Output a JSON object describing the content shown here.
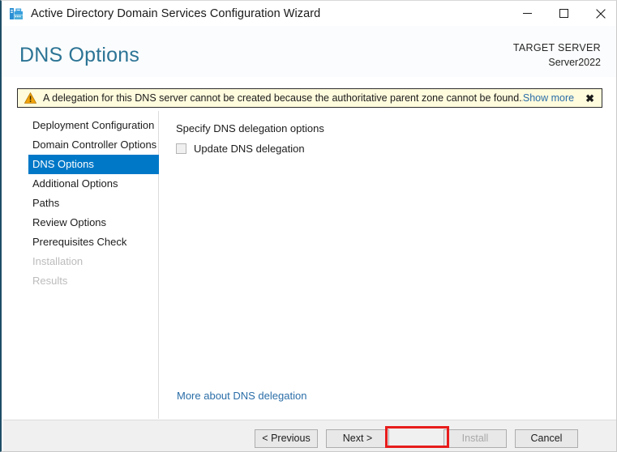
{
  "window": {
    "title": "Active Directory Domain Services Configuration Wizard",
    "app_icon": "server-wizard-icon",
    "controls": {
      "minimize": "—",
      "maximize": "□",
      "close": "✕"
    }
  },
  "header": {
    "page_title": "DNS Options",
    "target_server_label": "TARGET SERVER",
    "target_server_name": "Server2022",
    "title_color": "#2c7495"
  },
  "warning": {
    "icon": "warning-triangle-icon",
    "message": "A delegation for this DNS server cannot be created because the authoritative parent zone cannot be found...",
    "show_more": "Show more",
    "close": "✖",
    "background": "#fffbdd",
    "border": "#2b2b2b",
    "link_color": "#2b6ea8"
  },
  "sidebar": {
    "selected_color": "#0078c8",
    "items": [
      {
        "label": "Deployment Configuration",
        "state": "normal"
      },
      {
        "label": "Domain Controller Options",
        "state": "normal"
      },
      {
        "label": "DNS Options",
        "state": "selected"
      },
      {
        "label": "Additional Options",
        "state": "normal"
      },
      {
        "label": "Paths",
        "state": "normal"
      },
      {
        "label": "Review Options",
        "state": "normal"
      },
      {
        "label": "Prerequisites Check",
        "state": "normal"
      },
      {
        "label": "Installation",
        "state": "disabled"
      },
      {
        "label": "Results",
        "state": "disabled"
      }
    ]
  },
  "content": {
    "heading": "Specify DNS delegation options",
    "checkbox_label": "Update DNS delegation",
    "checkbox_checked": false,
    "link": "More about DNS delegation",
    "link_color": "#2b6ea8"
  },
  "footer": {
    "previous": "< Previous",
    "next": "Next >",
    "install": "Install",
    "cancel": "Cancel",
    "install_enabled": false,
    "highlight_color": "#e81c1c"
  }
}
